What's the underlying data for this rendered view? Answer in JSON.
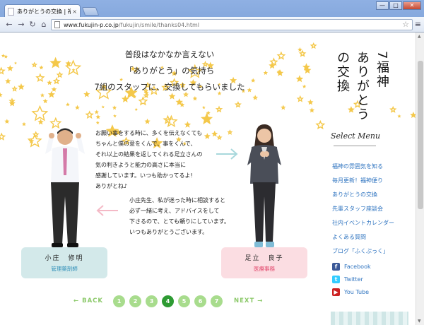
{
  "browser": {
    "tab_title": "ありがとうの交換 | 福神調剤",
    "tab_close": "×",
    "url_host": "www.fukujin-p.co.jp",
    "url_path": "/fukujin/smile/thanks04.html",
    "win_min": "—",
    "win_max": "□",
    "win_close": "✕"
  },
  "page": {
    "intro_lines": [
      "普段はなかなか言えない",
      "「ありがとう」の気持ち",
      "7組のスタッフに、交換してもらいました"
    ],
    "vertical_title": [
      "7福神",
      "ありがとう",
      "の交換"
    ],
    "message_1": [
      "お願い事をする時に、多くを伝えなくても",
      "ちゃんと僕の意をくんで、事をくんで、",
      "それ以上の結果を返してくれる足立さんの",
      "気の利きようと能力の高さに本当に",
      "感謝しています。いつも助かってるよ!",
      "ありがとね♪"
    ],
    "message_2": [
      "小庄先生、私が迷った時に相談すると",
      "必ず一緒に考え、アドバイスをして",
      "下さるので、とても頼りにしています。",
      "いつもありがとうございます。"
    ],
    "person_left": {
      "name": "小庄　修明",
      "role": "管理薬剤師"
    },
    "person_right": {
      "name": "足立　良子",
      "role": "医療事務"
    },
    "pager": {
      "back": "BACK",
      "next": "NEXT",
      "pages": [
        "1",
        "2",
        "3",
        "4",
        "5",
        "6",
        "7"
      ],
      "current": "4"
    }
  },
  "sidebar": {
    "menu_title": "Select Menu",
    "items": [
      "福神の雰囲気を知る",
      "毎月更新！福神便り",
      "ありがとうの交換",
      "先輩スタッフ座談会",
      "社内イベントカレンダー",
      "よくある質問",
      "ブログ「ふくぷっく」"
    ],
    "social": [
      {
        "label": "Facebook",
        "icon": "facebook-icon",
        "glyph": "f"
      },
      {
        "label": "Twitter",
        "icon": "twitter-icon",
        "glyph": "t"
      },
      {
        "label": "You Tube",
        "icon": "youtube-icon",
        "glyph": "▶"
      }
    ]
  },
  "colors": {
    "accent_green": "#8cc96a",
    "active_green": "#2e9b33",
    "link_blue": "#2f74c0",
    "star_yellow": "#f4c84a",
    "card_blue": "#d3e9ea",
    "card_pink": "#fbdde2"
  }
}
